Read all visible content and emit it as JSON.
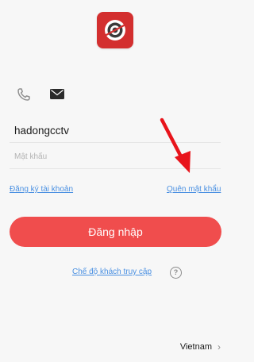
{
  "login_tabs": {
    "phone_icon": "phone-icon",
    "email_icon": "envelope-icon"
  },
  "form": {
    "username_value": "hadongcctv",
    "password_placeholder": "Mật khẩu"
  },
  "links": {
    "register": "Đăng ký tài khoản",
    "forgot_password": "Quên mật khẩu",
    "guest_mode": "Chế độ khách truy cập"
  },
  "login_button_label": "Đăng nhập",
  "help_symbol": "?",
  "region": {
    "label": "Vietnam",
    "chevron": "›"
  },
  "colors": {
    "brand_red": "#d32f2f",
    "button_red": "#f04d4d",
    "link_blue": "#4a90e2",
    "annotation_red": "#e8141b"
  }
}
